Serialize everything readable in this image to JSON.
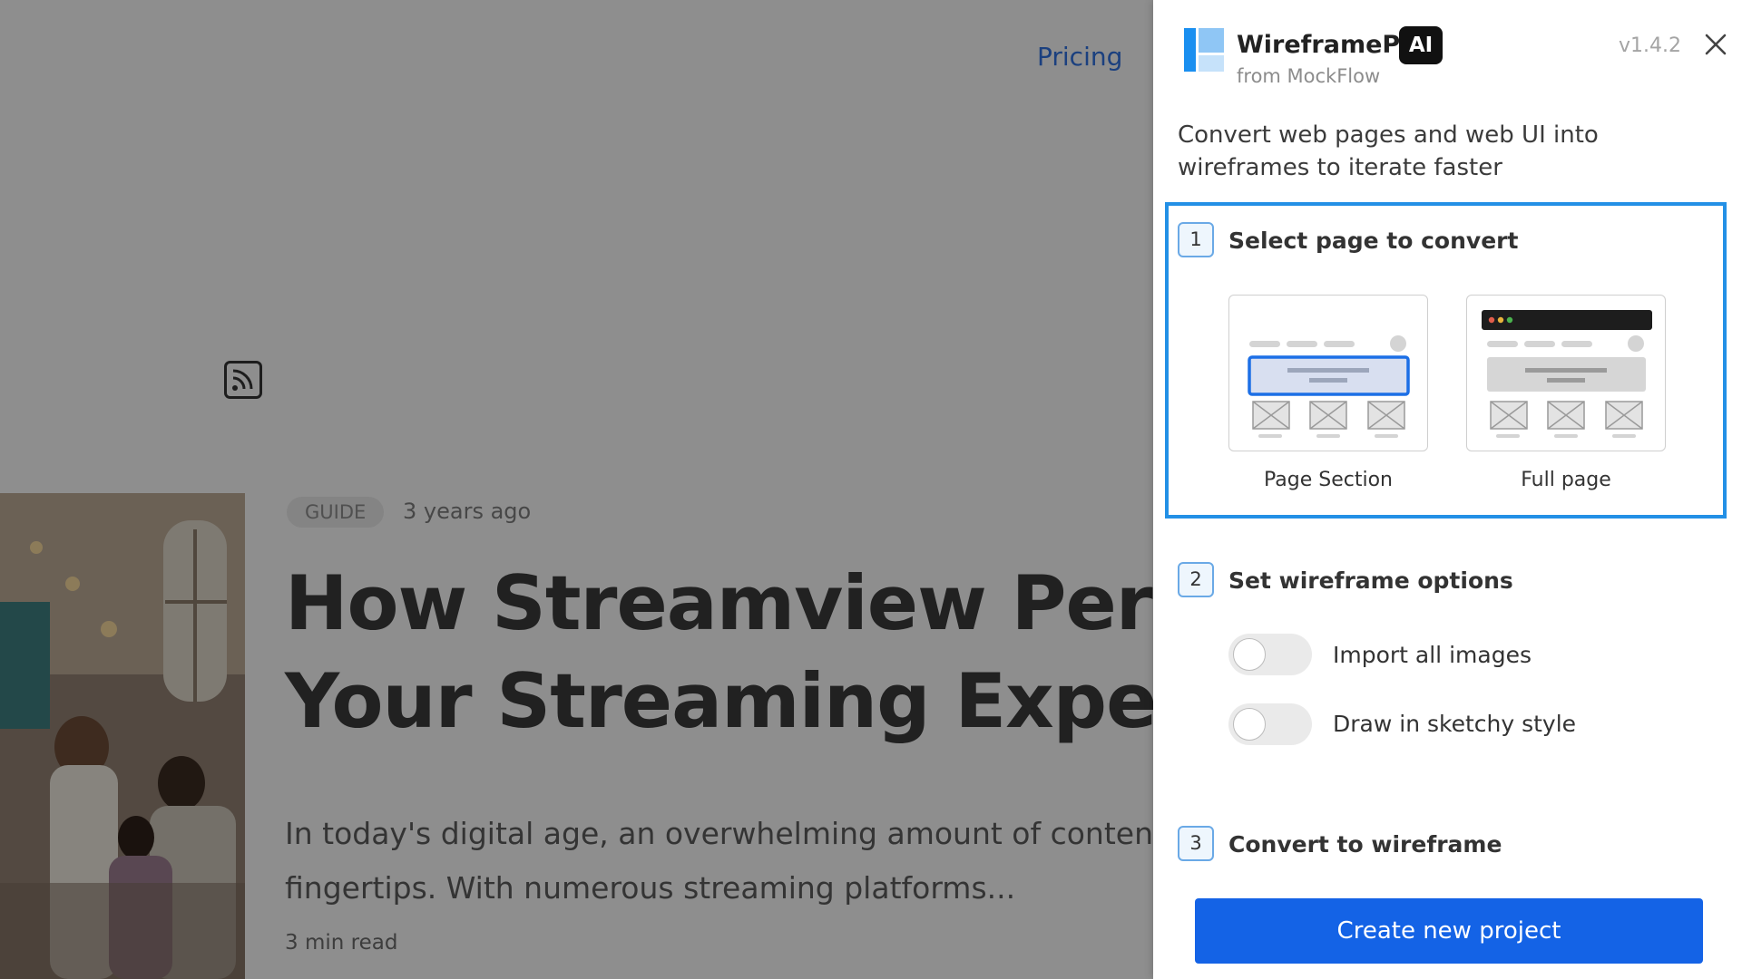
{
  "background_page": {
    "nav": {
      "pricing": "Pricing"
    },
    "article": {
      "tag": "GUIDE",
      "time": "3 years ago",
      "title_line1": "How Streamview Persona",
      "title_line2": "Your Streaming Experien",
      "excerpt_line1": "In today's digital age, an overwhelming amount of content is",
      "excerpt_line2": "fingertips. With numerous streaming platforms...",
      "read_time": "3 min read"
    }
  },
  "panel": {
    "app_name": "WireframePro",
    "badge": "AI",
    "from": "from MockFlow",
    "version": "v1.4.2",
    "description": "Convert web pages and web UI into wireframes to iterate faster",
    "step1": {
      "number": "1",
      "title": "Select page to convert",
      "options": [
        {
          "label": "Page Section"
        },
        {
          "label": "Full page"
        }
      ]
    },
    "step2": {
      "number": "2",
      "title": "Set wireframe options",
      "toggles": [
        {
          "label": "Import all images",
          "on": false
        },
        {
          "label": "Draw in sketchy style",
          "on": false
        }
      ]
    },
    "step3": {
      "number": "3",
      "title": "Convert to wireframe"
    },
    "create_button": "Create new project"
  },
  "colors": {
    "accent_blue": "#2390e6",
    "button_blue": "#1463e6",
    "pricing_link": "#2f6fdb"
  },
  "icons": [
    "rss-icon",
    "close-icon",
    "wireframepro-logo-icon"
  ]
}
